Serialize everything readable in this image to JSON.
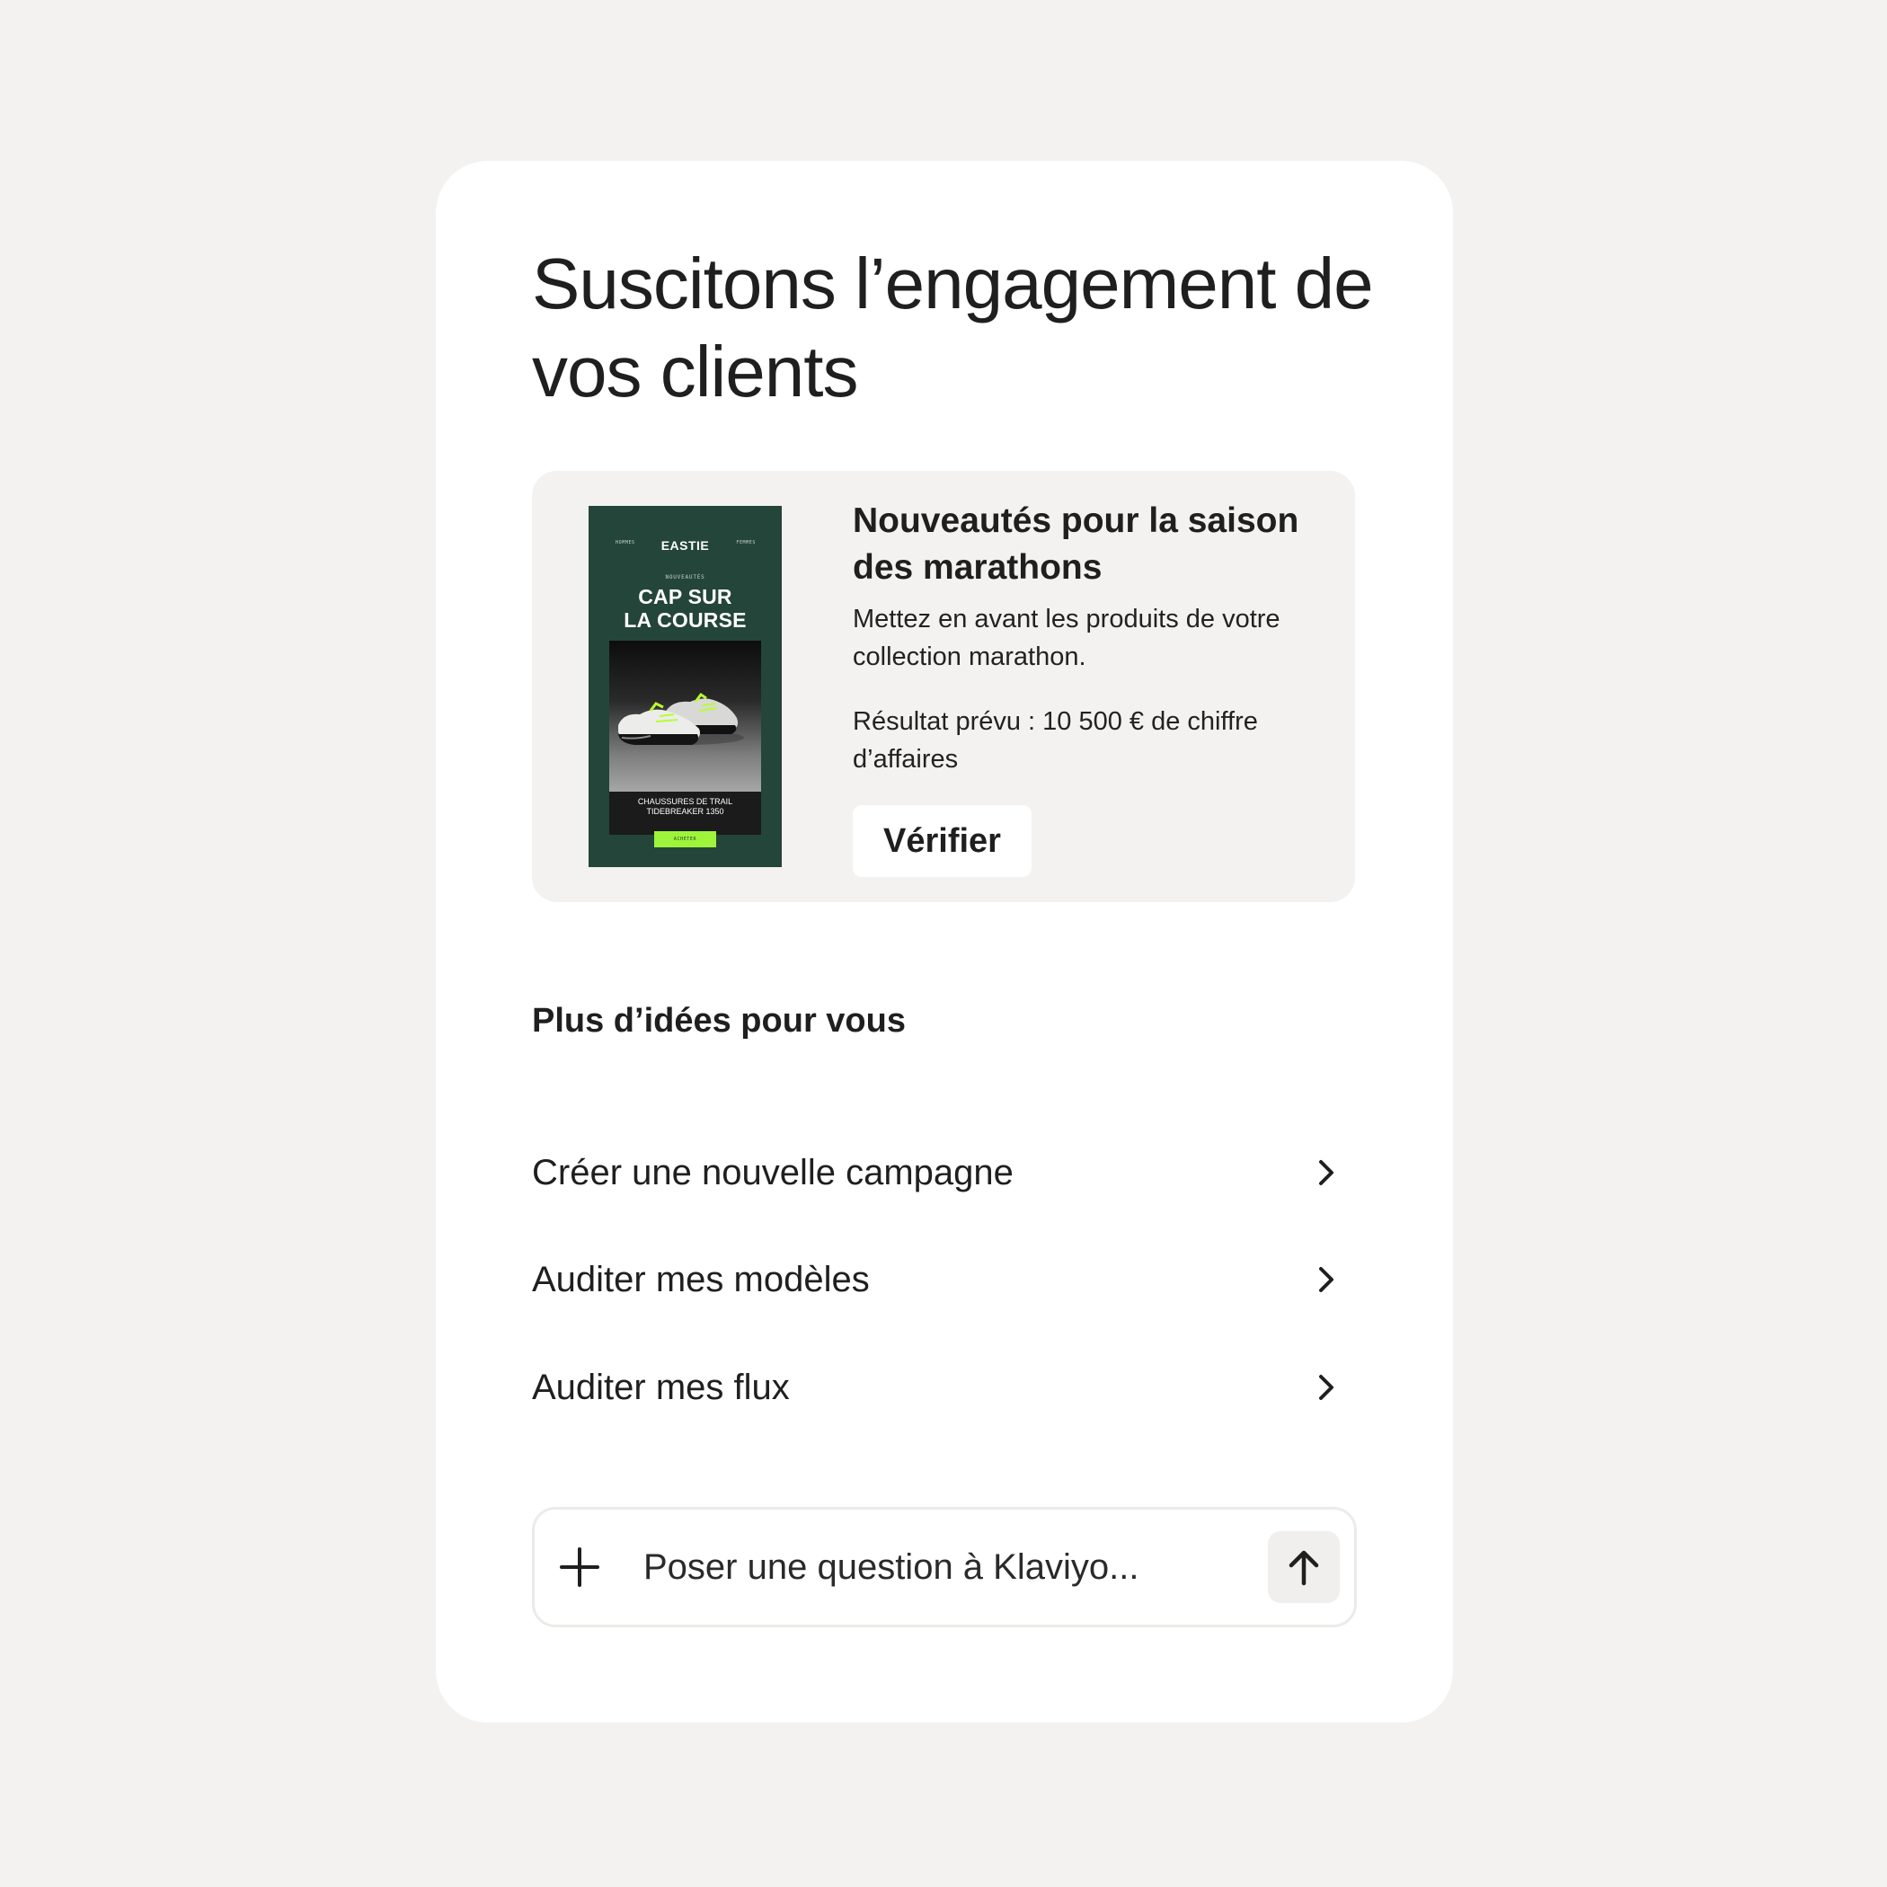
{
  "header": {
    "title": "Suscitons l’engagement de vos clients"
  },
  "recommendation": {
    "title": "Nouveautés pour la saison des marathons",
    "description": "Mettez en avant les produits de votre collection marathon.",
    "result": "Résultat prévu : 10 500 € de chiffre d’affaires",
    "verify_label": "Vérifier",
    "email_preview": {
      "nav_left": "HOMMES",
      "brand": "EASTIE",
      "nav_right": "FEMMES",
      "eyebrow": "NOUVEAUTÉS",
      "headline_line1": "CAP SUR",
      "headline_line2": "LA COURSE",
      "product_line1": "CHAUSSURES DE TRAIL",
      "product_line2": "TIDEBREAKER 1350",
      "cta": "ACHETER",
      "background_color": "#24453a",
      "accent_color": "#9ef33b"
    }
  },
  "ideas": {
    "heading": "Plus d’idées pour vous",
    "items": [
      {
        "label": "Créer une nouvelle campagne",
        "icon": "chevron-right-icon"
      },
      {
        "label": "Auditer mes modèles",
        "icon": "chevron-right-icon"
      },
      {
        "label": "Auditer mes flux",
        "icon": "chevron-right-icon"
      }
    ]
  },
  "chat": {
    "placeholder": "Poser une question à Klaviyo...",
    "attach_icon": "plus-icon",
    "send_icon": "arrow-up-icon"
  },
  "colors": {
    "page_background": "#f3f2f0",
    "panel_background": "#ffffff",
    "card_background": "#f3f2f0",
    "text": "#1f1f1f"
  }
}
